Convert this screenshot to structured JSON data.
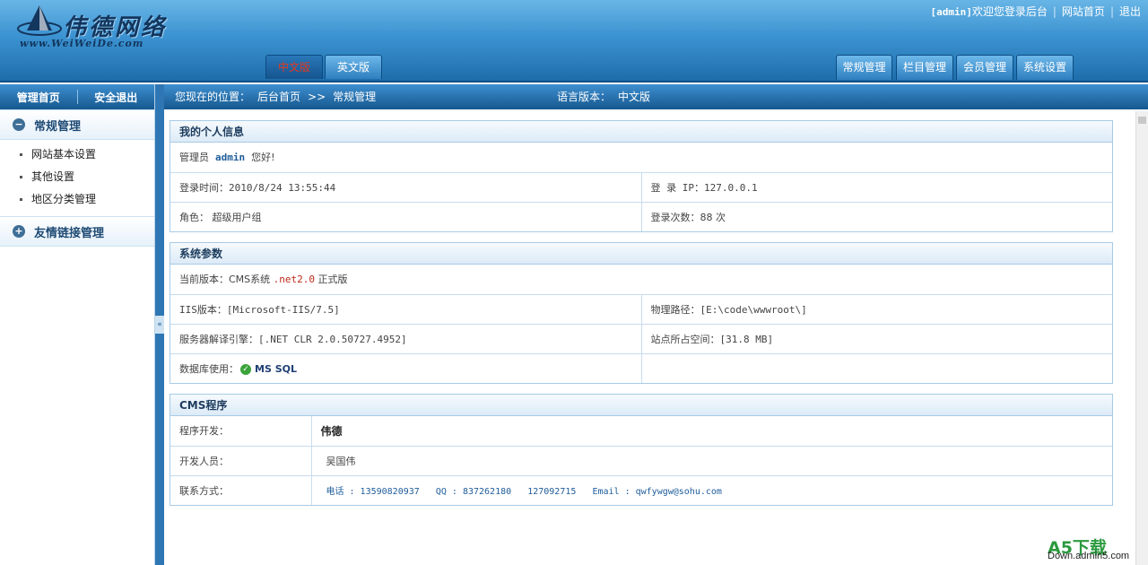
{
  "header": {
    "logo_text": "伟德网络",
    "logo_sub": "www.WeiWeiDe.com",
    "user_tag": "[admin]",
    "welcome": "欢迎您登录后台",
    "site_home": "网站首页",
    "logout": "退出",
    "lang_tabs": [
      "中文版",
      "英文版"
    ],
    "nav_tabs": [
      "常规管理",
      "栏目管理",
      "会员管理",
      "系统设置"
    ]
  },
  "sidebar": {
    "top_home": "管理首页",
    "top_exit": "安全退出",
    "group1": "常规管理",
    "group1_icon": "minus-circle-icon",
    "items": [
      "网站基本设置",
      "其他设置",
      "地区分类管理"
    ],
    "group2": "友情链接管理",
    "group2_icon": "plus-circle-icon",
    "collapse": "«"
  },
  "breadcrumb": {
    "label": "您现在的位置：",
    "home": "后台首页",
    "arrow": ">>",
    "current": "常规管理",
    "lang_label": "语言版本：",
    "lang_value": "中文版"
  },
  "personal": {
    "title": "我的个人信息",
    "greet_pre": "管理员",
    "greet_user": "admin",
    "greet_post": "您好!",
    "login_time": "登录时间：2010/8/24 13:55:44",
    "login_ip": "登 录 IP：127.0.0.1",
    "role": "角色： 超级用户组",
    "login_count": "登录次数：88 次"
  },
  "system": {
    "title": "系统参数",
    "version_pre": "当前版本：CMS系统",
    "version_hi": ".net2.0",
    "version_post": "正式版",
    "iis": "IIS版本：[Microsoft-IIS/7.5]",
    "path": "物理路径：[E:\\code\\wwwroot\\]",
    "engine": "服务器解译引擎：[.NET CLR 2.0.50727.4952]",
    "space": "站点所占空间：[31.8 MB]",
    "db_label": "数据库使用：",
    "db_value": "MS SQL"
  },
  "cms": {
    "title": "CMS程序",
    "dev_label": "程序开发：",
    "dev_value": "伟德",
    "staff_label": "开发人员：",
    "staff_value": "吴国伟",
    "contact_label": "联系方式：",
    "contact_value": "电话 : 13590820937   QQ : 837262180   127092715   Email : qwfywgw@sohu.com"
  },
  "watermark": {
    "brand": "A5下载",
    "url": "Down.admin5.com"
  },
  "colors": {
    "header_blue": "#3c93d1",
    "bar_blue": "#16588f",
    "panel_border": "#a8cbe6",
    "highlight_red": "#c0281a"
  }
}
